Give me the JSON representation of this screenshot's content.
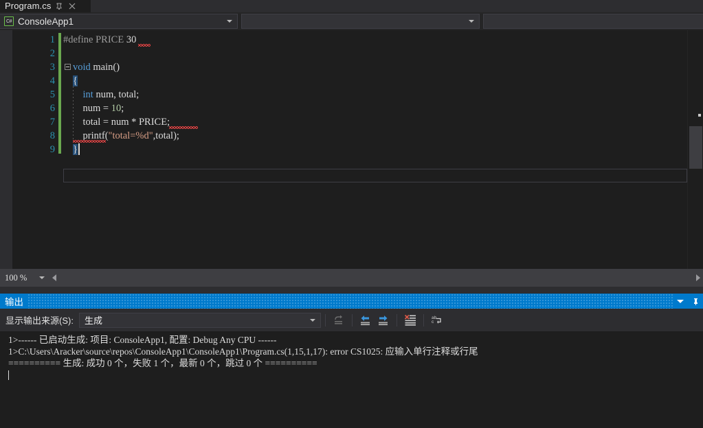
{
  "window": {
    "theme_bg": "#2d2d30",
    "editor_bg": "#1e1e1e",
    "accent": "#007acc"
  },
  "tabstrip": {
    "tab_title": "Program.cs",
    "pin_icon": "pin-icon",
    "close_icon": "close-icon"
  },
  "navbar": {
    "project_badge": "C#",
    "project_name": "ConsoleApp1",
    "type_dropdown_value": "",
    "member_dropdown_value": ""
  },
  "editor": {
    "language": "csharp",
    "line_numbers": [
      "1",
      "2",
      "3",
      "4",
      "5",
      "6",
      "7",
      "8",
      "9"
    ],
    "lines": [
      {
        "n": "1",
        "text": "#define PRICE 30"
      },
      {
        "n": "2",
        "text": ""
      },
      {
        "n": "3",
        "text": "void main()"
      },
      {
        "n": "4",
        "text": "{"
      },
      {
        "n": "5",
        "text": "    int num, total;"
      },
      {
        "n": "6",
        "text": "    num = 10;"
      },
      {
        "n": "7",
        "text": "    total = num * PRICE;"
      },
      {
        "n": "8",
        "text": "    printf(\"total=%d\",total);"
      },
      {
        "n": "9",
        "text": "}"
      }
    ],
    "tokens": {
      "l1_pp": "#define PRICE ",
      "l1_num": "30",
      "l3_kw": "void",
      "l3_rest": " main()",
      "l4_brace": "{",
      "l5_kw": "int",
      "l5_rest": " num, total;",
      "l6_a": "num = ",
      "l6_num": "10",
      "l6_b": ";",
      "l7_text": "total = num * PRICE;",
      "l8_a": "printf(",
      "l8_str": "\"total=%d\"",
      "l8_b": ",total);",
      "l9_brace": "}"
    }
  },
  "zoombar": {
    "zoom_level": "100 %",
    "scroll_left_icon": "arrow-left-icon",
    "scroll_right_icon": "arrow-right-icon"
  },
  "output_panel": {
    "title": "输出",
    "source_label": "显示输出来源(S):",
    "source_value": "生成",
    "toolbar_buttons": [
      "jump-to-previous-icon",
      "navigate-backward-icon",
      "navigate-forward-icon",
      "clear-all-icon",
      "toggle-word-wrap-icon"
    ],
    "dropdown_icon": "chevron-down-icon",
    "pin_icon": "pin-icon",
    "lines": [
      "1>------ 已启动生成: 项目: ConsoleApp1, 配置: Debug Any CPU ------",
      "1>C:\\Users\\Aracker\\source\\repos\\ConsoleApp1\\ConsoleApp1\\Program.cs(1,15,1,17): error CS1025: 应输入单行注释或行尾",
      "========== 生成: 成功 0 个，失败 1 个，最新 0 个，跳过 0 个 =========="
    ]
  }
}
